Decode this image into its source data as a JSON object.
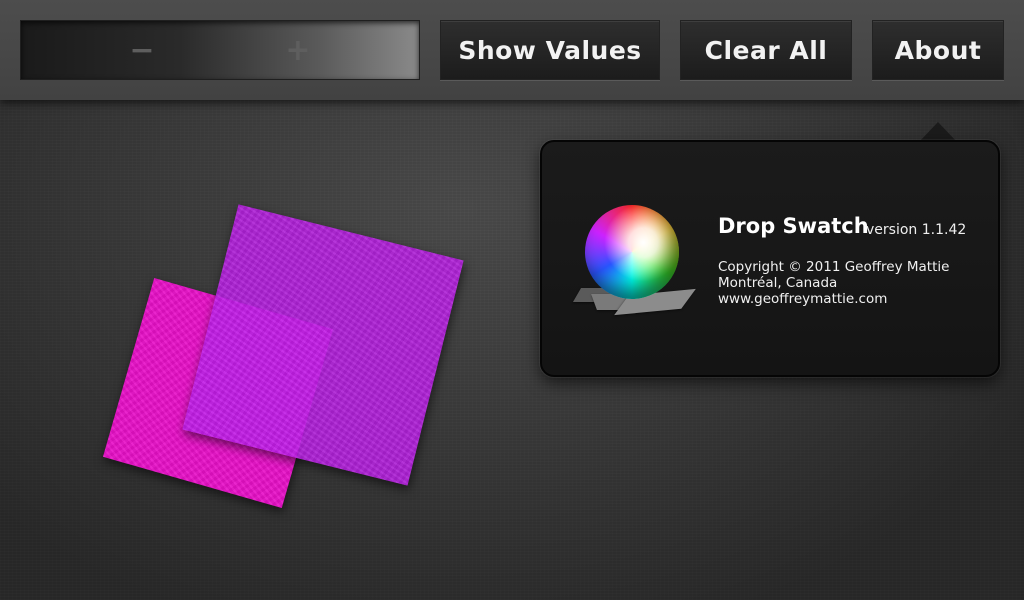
{
  "toolbar": {
    "zoom": {
      "minus_label": "−",
      "plus_label": "+"
    },
    "show_values_label": "Show Values",
    "clear_all_label": "Clear All",
    "about_label": "About"
  },
  "swatches": [
    {
      "name": "magenta",
      "color": "#e810c8"
    },
    {
      "name": "purple",
      "color": "#be1eeb"
    }
  ],
  "about": {
    "app_name": "Drop Swatch",
    "version": "version 1.1.42",
    "copyright": "Copyright © 2011 Geoffrey Mattie",
    "location": "Montréal, Canada",
    "website": "www.geoffreymattie.com",
    "logo_icon": "color-sphere-icon"
  }
}
